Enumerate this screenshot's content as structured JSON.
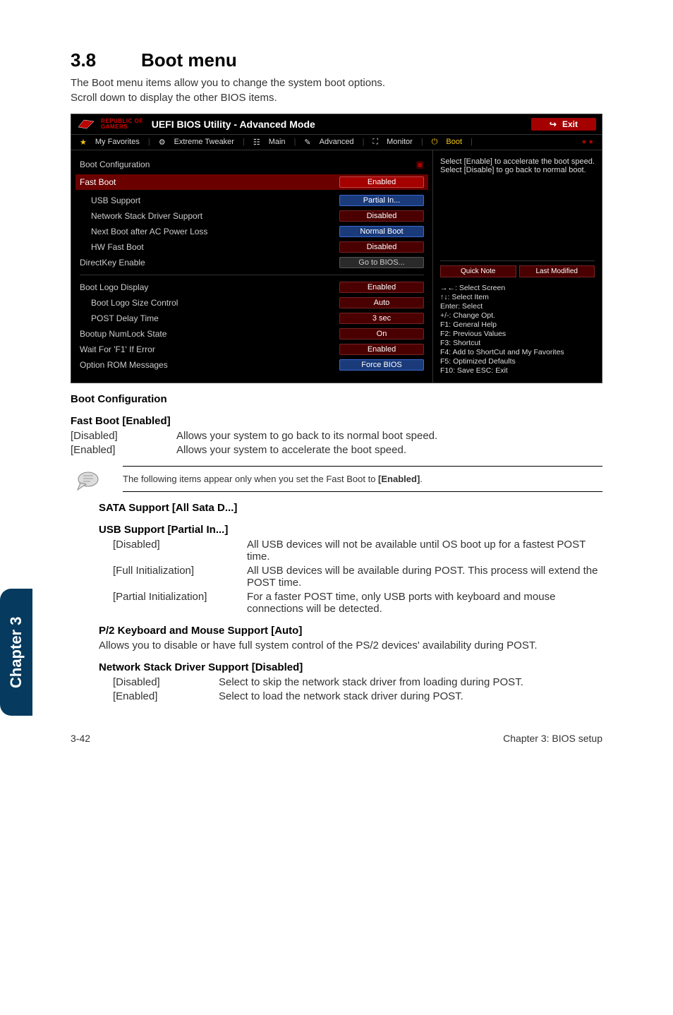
{
  "section": {
    "num": "3.8",
    "title": "Boot menu"
  },
  "intro1": "The Boot menu items allow you to change the system boot options.",
  "intro2": "Scroll down to display the other BIOS items.",
  "bios": {
    "logo_line1": "REPUBLIC OF",
    "logo_line2": "GAMERS",
    "title": "UEFI BIOS Utility - Advanced Mode",
    "exit_icon": "↪",
    "exit": "Exit",
    "tabs": {
      "fav": "My Favorites",
      "tweak": "Extreme Tweaker",
      "main": "Main",
      "adv": "Advanced",
      "mon": "Monitor",
      "boot": "Boot"
    },
    "left": {
      "boot_config": "Boot Configuration",
      "fast_boot": {
        "label": "Fast Boot",
        "value": "Enabled"
      },
      "usb_support": {
        "label": "USB Support",
        "value": "Partial In..."
      },
      "net_stack": {
        "label": "Network Stack Driver Support",
        "value": "Disabled"
      },
      "next_boot": {
        "label": "Next Boot after AC Power Loss",
        "value": "Normal Boot"
      },
      "hw_fast": {
        "label": "HW Fast Boot",
        "value": "Disabled"
      },
      "directkey": {
        "label": "DirectKey Enable",
        "value": "Go to BIOS..."
      },
      "boot_logo": {
        "label": "Boot Logo Display",
        "value": "Enabled"
      },
      "logo_size": {
        "label": "Boot Logo Size Control",
        "value": "Auto"
      },
      "post_delay": {
        "label": "POST Delay Time",
        "value": "3 sec"
      },
      "numlock": {
        "label": "Bootup NumLock State",
        "value": "On"
      },
      "wait_f1": {
        "label": "Wait For 'F1' If Error",
        "value": "Enabled"
      },
      "rom_msg": {
        "label": "Option ROM Messages",
        "value": "Force BIOS"
      }
    },
    "right": {
      "help": "Select [Enable] to accelerate the boot speed. Select [Disable] to go back to normal boot.",
      "quick": "Quick Note",
      "last": "Last Modified",
      "keys_sel": "→←: Select Screen",
      "keys_item": "↑↓: Select Item",
      "keys_enter": "Enter: Select",
      "keys_change": "+/-: Change Opt.",
      "keys_f1": "F1: General Help",
      "keys_f2": "F2: Previous Values",
      "keys_f3": "F3: Shortcut",
      "keys_f4": "F4: Add to ShortCut and My Favorites",
      "keys_f5": "F5: Optimized Defaults",
      "keys_f10": "F10: Save  ESC: Exit"
    }
  },
  "headings": {
    "boot_config": "Boot Configuration",
    "fast_boot": "Fast Boot [Enabled]",
    "sata": "SATA Support [All Sata D...]",
    "usb": "USB Support [Partial In...]",
    "ps2": "P/2 Keyboard and Mouse Support [Auto]",
    "net": "Network Stack Driver Support [Disabled]"
  },
  "fastboot_opts": {
    "disabled_k": "[Disabled]",
    "disabled_v": "Allows your system to go back to its normal boot speed.",
    "enabled_k": "[Enabled]",
    "enabled_v": "Allows your system to accelerate the boot speed."
  },
  "note": "The following items appear only when you set the Fast Boot to [Enabled].",
  "usb_opts": {
    "disabled_k": "[Disabled]",
    "disabled_v": "All USB devices will not be available until OS boot up for a fastest POST time.",
    "full_k": "[Full Initialization]",
    "full_v": "All USB devices will be available during POST. This process will extend the POST time.",
    "partial_k": "[Partial Initialization]",
    "partial_v": "For a faster POST time, only USB ports with keyboard and mouse connections will be detected."
  },
  "ps2_text": "Allows you to disable or have full system control of the PS/2 devices' availability during POST.",
  "net_opts": {
    "disabled_k": "[Disabled]",
    "disabled_v": "Select to skip the network stack driver from loading during POST.",
    "enabled_k": "[Enabled]",
    "enabled_v": "Select to load the network stack driver during POST."
  },
  "chapter_tab": "Chapter 3",
  "footer": {
    "left": "3-42",
    "right": "Chapter 3: BIOS setup"
  }
}
